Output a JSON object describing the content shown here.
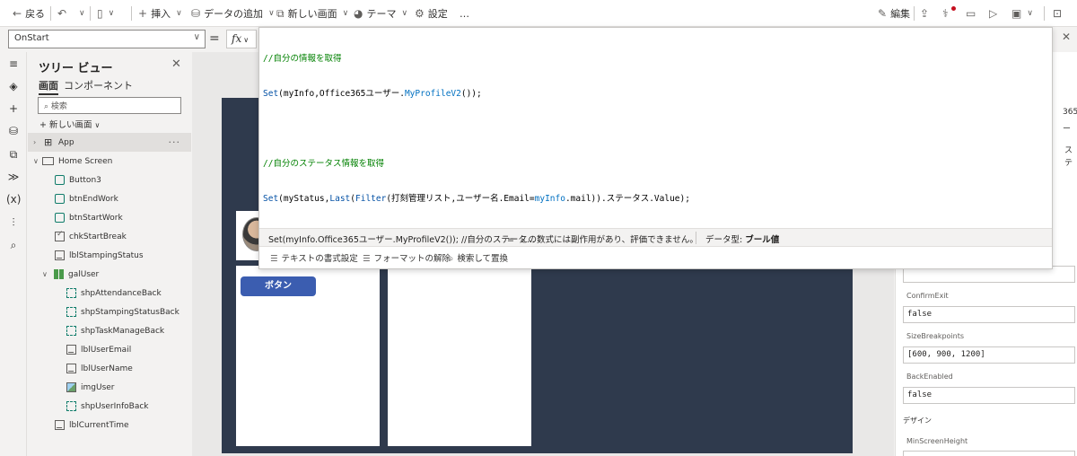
{
  "toolbar": {
    "back": "戻る",
    "insert": "挿入",
    "add_data": "データの追加",
    "new_screen": "新しい画面",
    "theme": "テーマ",
    "settings": "設定",
    "more": "…",
    "edit": "編集"
  },
  "formula_bar": {
    "property": "OnStart",
    "equals": "=",
    "fx": "fx"
  },
  "tree": {
    "title": "ツリー ビュー",
    "tab_screens": "画面",
    "tab_components": "コンポーネント",
    "search_placeholder": "検索",
    "new_screen": "新しい画面",
    "app": "App",
    "home_screen": "Home Screen",
    "nodes": [
      {
        "label": "Button3"
      },
      {
        "label": "btnEndWork"
      },
      {
        "label": "btnStartWork"
      },
      {
        "label": "chkStartBreak"
      },
      {
        "label": "lblStampingStatus"
      },
      {
        "label": "galUser"
      },
      {
        "label": "shpAttendanceBack"
      },
      {
        "label": "shpStampingStatusBack"
      },
      {
        "label": "shpTaskManageBack"
      },
      {
        "label": "lblUserEmail"
      },
      {
        "label": "lblUserName"
      },
      {
        "label": "imgUser"
      },
      {
        "label": "shpUserInfoBack"
      },
      {
        "label": "lblCurrentTime"
      }
    ]
  },
  "canvas": {
    "button_label": "ボタン"
  },
  "editor": {
    "lines": {
      "c1": "//自分の情報を取得",
      "l2_fn": "Set",
      "l2_a": "(myInfo,Office365ユーザー.",
      "l2_fn2": "MyProfileV2",
      "l2_b": "());",
      "c4": "//自分のステータス情報を取得",
      "l5_fn": "Set",
      "l5_a": "(myStatus,",
      "l5_fn2": "Last",
      "l5_b": "(",
      "l5_fn3": "Filter",
      "l5_c": "(打刻管理リスト,ユーザー名.Email=",
      "l5_var": "myInfo",
      "l5_d": ".mail)).ステータス.Value);"
    },
    "result_expr": "Set(myInfo.Office365ユーザー.MyProfileV2()); //自分のステータ...",
    "result_eq": "=",
    "result_msg": "この数式には副作用があり、評価できません。",
    "result_type_label": "データ型:",
    "result_type_value": "ブール値",
    "tool_format": "テキストの書式設定",
    "tool_unformat": "フォーマットの解除",
    "tool_find": "検索して置換"
  },
  "properties": {
    "frag1": "365",
    "frag2": "ー",
    "frag3": "ス",
    "frag4": "テ",
    "confirm_exit_label": "ConfirmExit",
    "confirm_exit_value": "false",
    "size_breakpoints_label": "SizeBreakpoints",
    "size_breakpoints_value": "[600, 900, 1200]",
    "back_enabled_label": "BackEnabled",
    "back_enabled_value": "false",
    "design_section": "デザイン",
    "min_screen_height_label": "MinScreenHeight"
  },
  "icons": {
    "back": "arrow-left-icon",
    "undo": "undo-icon",
    "paste": "paste-icon",
    "plus": "plus-icon",
    "database": "database-icon",
    "screen": "new-screen-icon",
    "theme": "palette-icon",
    "gear": "gear-icon",
    "pencil": "pencil-icon"
  },
  "colors": {
    "screen_background": "#2f3a4d",
    "button_fill": "#3b5db0",
    "comment": "#008000",
    "function": "#0451a5"
  }
}
